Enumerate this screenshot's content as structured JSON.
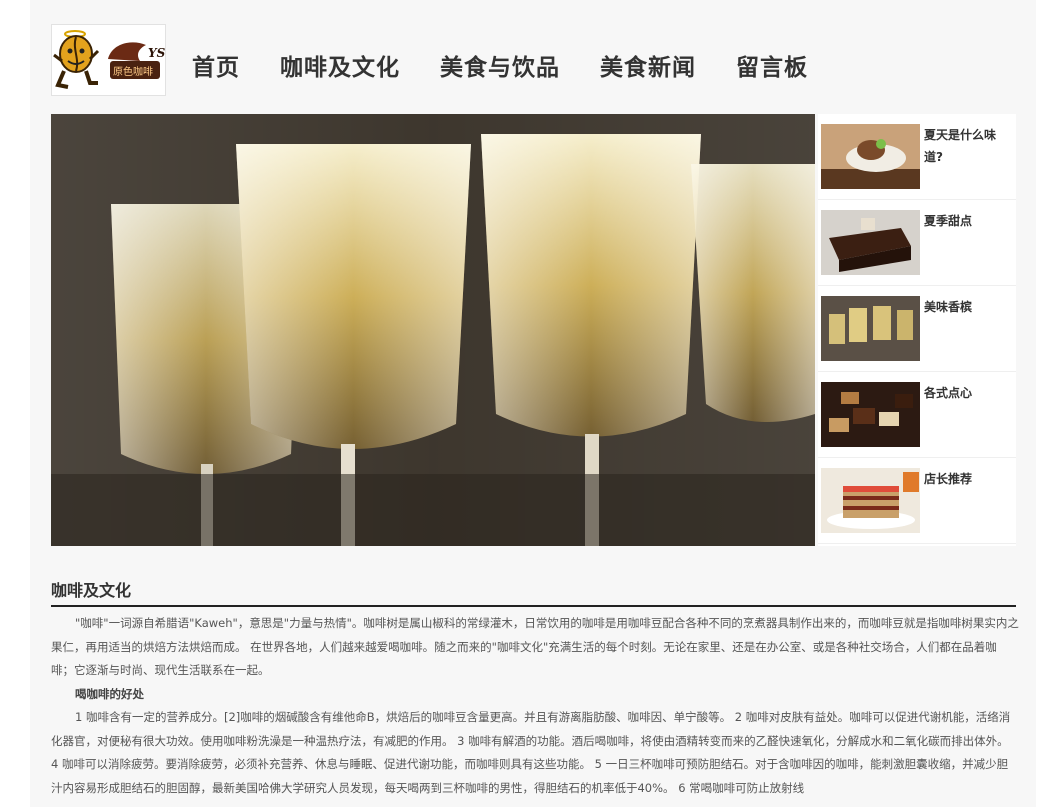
{
  "header": {
    "logo": {
      "icon": "coffee-bean-mascot",
      "text": "原色咖啡",
      "badge": "YS"
    },
    "nav": [
      "首页",
      "咖啡及文化",
      "美食与饮品",
      "美食新闻",
      "留言板"
    ]
  },
  "hero": {
    "image": "champagne-glasses-photo"
  },
  "sidebar": {
    "items": [
      {
        "title": "夏天是什么味道?",
        "image": "ice-cream-dessert"
      },
      {
        "title": "夏季甜点",
        "image": "chocolate-cake-slice"
      },
      {
        "title": "美味香槟",
        "image": "champagne-glasses"
      },
      {
        "title": "各式点心",
        "image": "assorted-pastries"
      },
      {
        "title": "店长推荐",
        "image": "layered-cake"
      }
    ]
  },
  "section": {
    "title": "咖啡及文化",
    "intro": "\"咖啡\"一词源自希腊语\"Kaweh\"，意思是\"力量与热情\"。咖啡树是属山椒科的常绿灌木，日常饮用的咖啡是用咖啡豆配合各种不同的烹煮器具制作出来的，而咖啡豆就是指咖啡树果实内之果仁，再用适当的烘焙方法烘焙而成。 在世界各地，人们越来越爱喝咖啡。随之而来的\"咖啡文化\"充满生活的每个时刻。无论在家里、还是在办公室、或是各种社交场合，人们都在品着咖啡；它逐渐与时尚、现代生活联系在一起。",
    "subheading": "喝咖啡的好处",
    "benefits": "1 咖啡含有一定的营养成分。[2]咖啡的烟碱酸含有维他命B，烘焙后的咖啡豆含量更高。并且有游离脂肪酸、咖啡因、单宁酸等。 2 咖啡对皮肤有益处。咖啡可以促进代谢机能，活络消化器官，对便秘有很大功效。使用咖啡粉洗澡是一种温热疗法，有减肥的作用。 3 咖啡有解酒的功能。酒后喝咖啡，将使由酒精转变而来的乙醛快速氧化，分解成水和二氧化碳而排出体外。 4 咖啡可以消除疲劳。要消除疲劳，必须补充营养、休息与睡眠、促进代谢功能，而咖啡则具有这些功能。 5 一日三杯咖啡可预防胆结石。对于含咖啡因的咖啡，能刺激胆囊收缩，并减少胆汁内容易形成胆结石的胆固醇，最新美国哈佛大学研究人员发现，每天喝两到三杯咖啡的男性，得胆结石的机率低于40%。 6 常喝咖啡可防止放射线"
  }
}
